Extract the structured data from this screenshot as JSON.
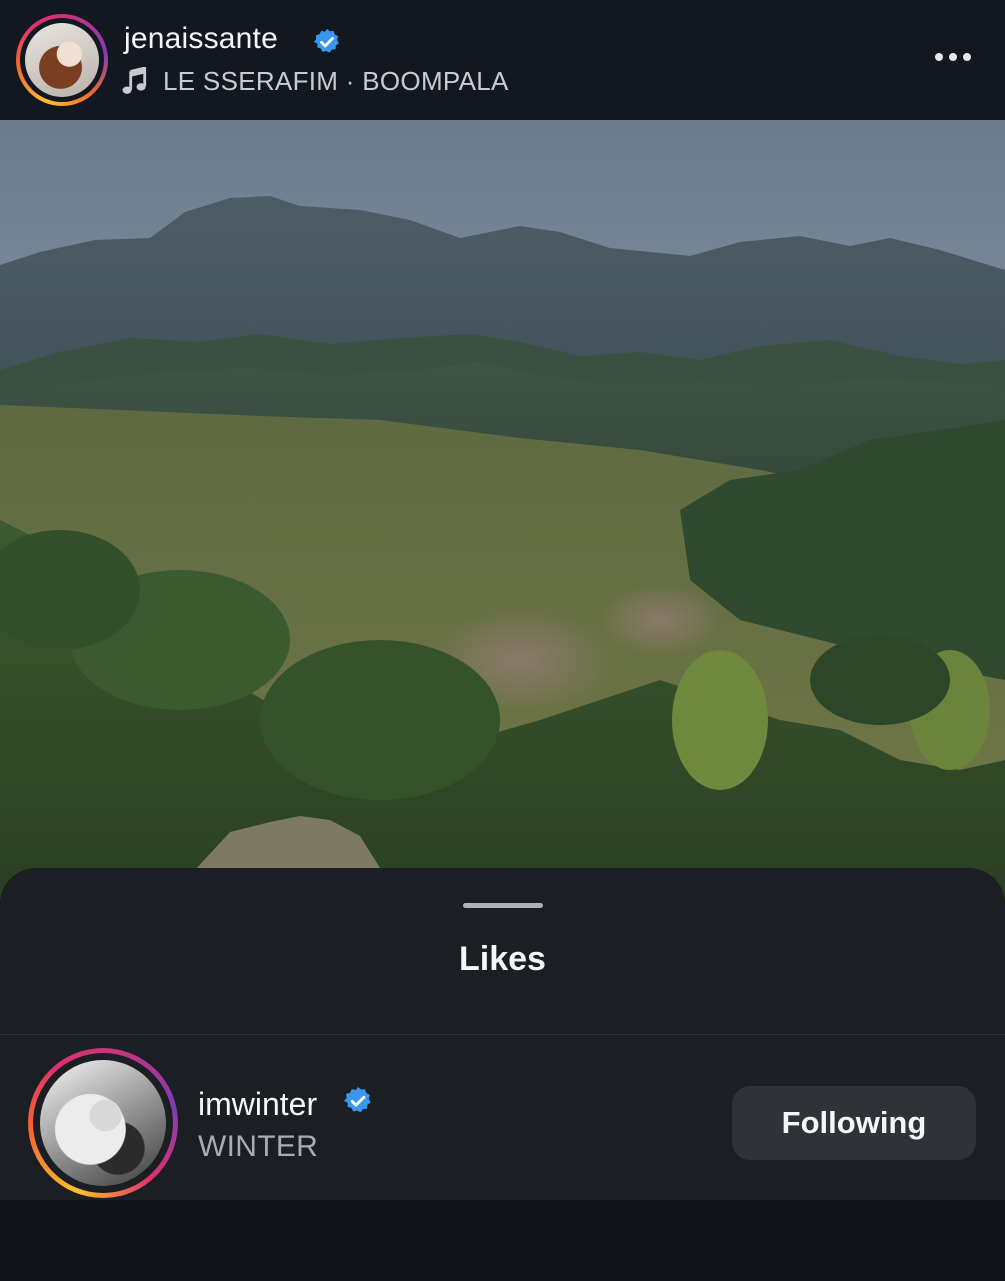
{
  "header": {
    "username": "jenaissante",
    "verified": true,
    "music": {
      "icon": "music-note-icon",
      "artist": "LE SSERAFIM",
      "separator": "·",
      "track": "BOOMPALA"
    },
    "more_icon": "more-horizontal-icon"
  },
  "photo": {
    "subject": "landscape photo"
  },
  "sheet": {
    "title": "Likes",
    "likers": [
      {
        "username": "imwinter",
        "verified": true,
        "full_name": "WINTER",
        "button_label": "Following"
      }
    ]
  },
  "colors": {
    "verified_badge": "#3897f0",
    "sheet_background": "#1b1e22",
    "button_background": "#2f3338",
    "secondary_text": "#a8adb4"
  }
}
